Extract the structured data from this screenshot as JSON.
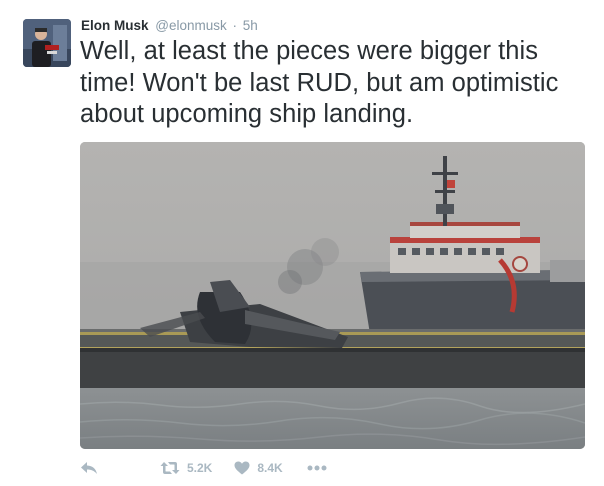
{
  "tweet": {
    "author_name": "Elon Musk",
    "handle": "@elonmusk",
    "separator": "·",
    "timestamp": "5h",
    "text": "Well, at least the pieces were bigger this time! Won't be last RUD, but am optimistic about upcoming ship landing."
  },
  "actions": {
    "reply_icon": "reply-icon",
    "retweet_icon": "retweet-icon",
    "retweet_count": "5.2K",
    "like_icon": "heart-icon",
    "like_count": "8.4K",
    "more_icon": "more-dots-icon"
  },
  "colors": {
    "text": "#292f33",
    "secondary": "#8899a6",
    "action_icons": "#aab8c2"
  }
}
